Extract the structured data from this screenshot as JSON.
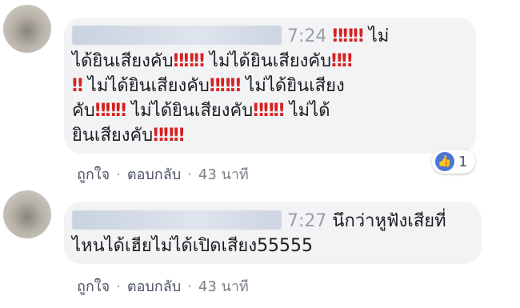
{
  "comments": [
    {
      "time": "7:24",
      "lines": [
        [
          {
            "t": "‼‼‼",
            "bang": true
          },
          {
            "t": " ไม่"
          }
        ],
        [
          {
            "t": "ได้ยินเสียงคับ"
          },
          {
            "t": "‼‼‼",
            "bang": true
          },
          {
            "t": " ไม่ได้ยินเสียงคับ"
          },
          {
            "t": "‼‼",
            "bang": true
          }
        ],
        [
          {
            "t": "‼",
            "bang": true
          },
          {
            "t": " ไม่ได้ยินเสียงคับ"
          },
          {
            "t": "‼‼‼",
            "bang": true
          },
          {
            "t": " ไม่ได้ยินเสียง"
          }
        ],
        [
          {
            "t": "คับ"
          },
          {
            "t": "‼‼‼",
            "bang": true
          },
          {
            "t": " ไม่ได้ยินเสียงคับ"
          },
          {
            "t": "‼‼‼",
            "bang": true
          },
          {
            "t": " ไม่ได้"
          }
        ],
        [
          {
            "t": "ยินเสียงคับ"
          },
          {
            "t": "‼‼‼",
            "bang": true
          }
        ]
      ],
      "reaction_icon": "thumbs-up-icon",
      "reaction_count": "1",
      "like_label": "ถูกใจ",
      "reply_label": "ตอบกลับ",
      "ago": "43 นาที"
    },
    {
      "time": "7:27",
      "first_line_text": "นึกว่าหูฟังเสียที่",
      "second_line_text": "ไหนได้เฮียไม่ได้เปิดเสียง55555",
      "like_label": "ถูกใจ",
      "reply_label": "ตอบกลับ",
      "ago": "43 นาที"
    }
  ],
  "separator": "·",
  "colors": {
    "bubble": "#f2f3f5",
    "like_blue": "#4a76d8",
    "exclaim_red": "#d52121"
  }
}
